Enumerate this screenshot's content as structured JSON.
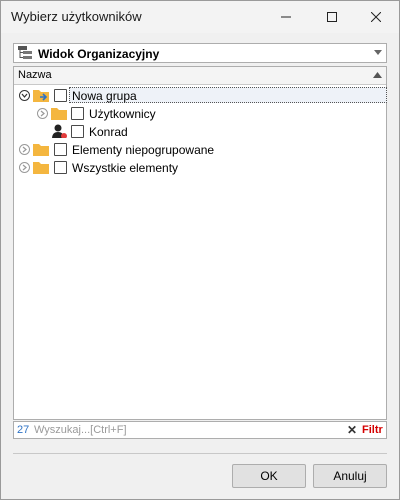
{
  "window": {
    "title": "Wybierz użytkowników"
  },
  "view_combo": {
    "value": "Widok Organizacyjny"
  },
  "tree": {
    "column_header": "Nazwa",
    "items": [
      {
        "label": "Nowa grupa",
        "type": "group",
        "selected": true
      },
      {
        "label": "Użytkownicy",
        "type": "folder"
      },
      {
        "label": "Konrad",
        "type": "user"
      },
      {
        "label": "Elementy niepogrupowane",
        "type": "folder"
      },
      {
        "label": "Wszystkie elementy",
        "type": "folder"
      }
    ]
  },
  "search": {
    "count": "27",
    "placeholder": "Wyszukaj...[Ctrl+F]",
    "clear": "✕",
    "filter_label": "Filtr"
  },
  "buttons": {
    "ok": "OK",
    "cancel": "Anuluj"
  },
  "colors": {
    "accent_blue": "#2f73c5",
    "filter_red": "#d40000",
    "folder": "#f4b63f"
  }
}
